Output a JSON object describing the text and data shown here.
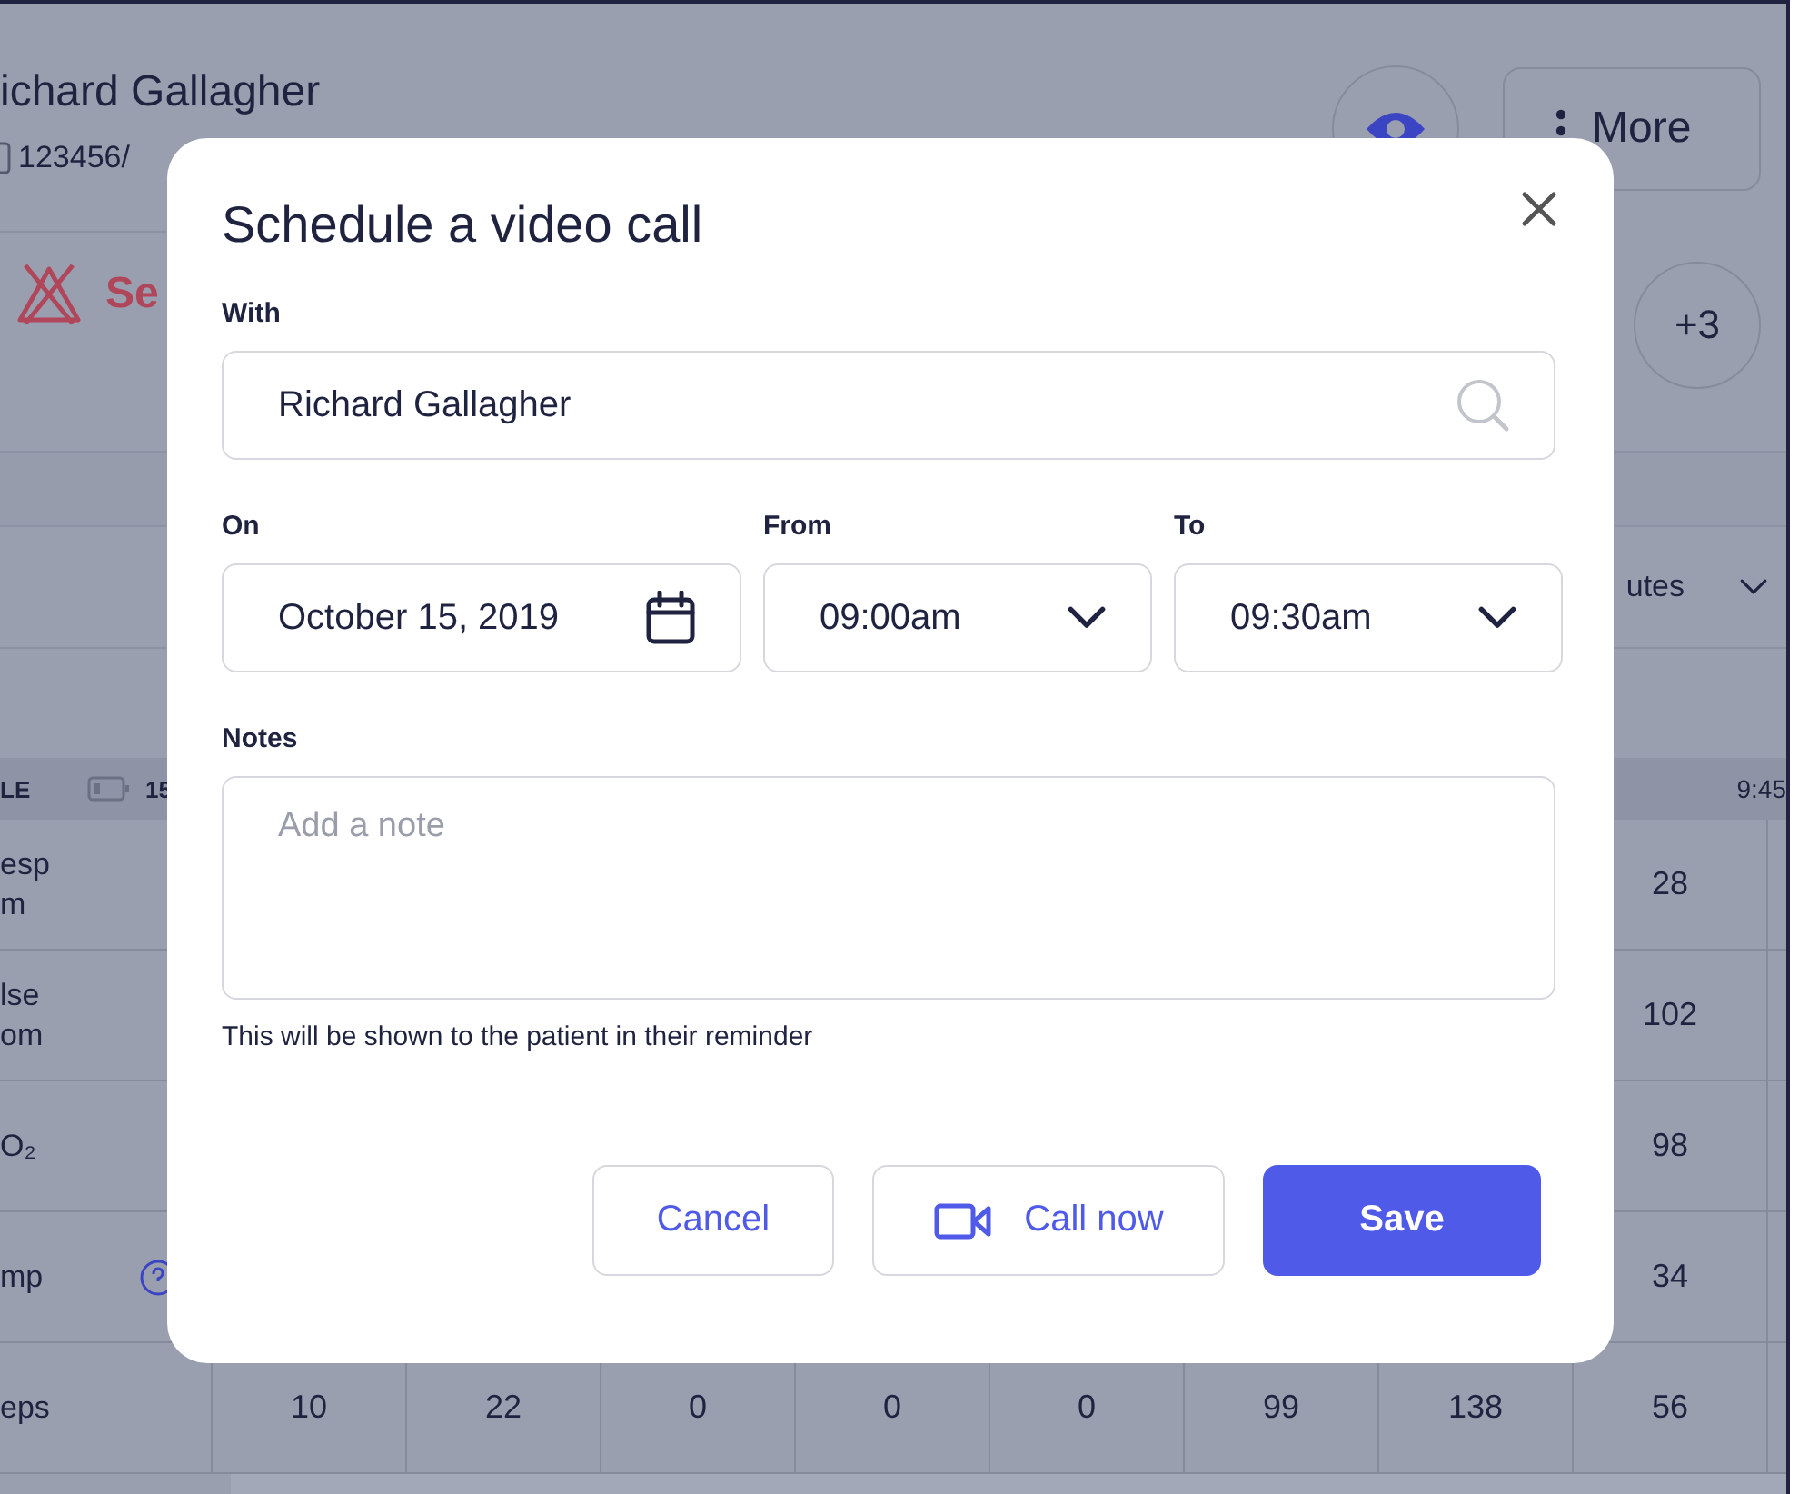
{
  "header": {
    "name": "ichard Gallagher",
    "id": "123456/",
    "alert": "Se",
    "more_button": "More",
    "extra_count": "+3"
  },
  "filter": {
    "value": "utes"
  },
  "table": {
    "header_label": "LE",
    "battery_reading": "15",
    "time": "9:45",
    "rows": [
      {
        "label": [
          "esp",
          "m"
        ],
        "help": false,
        "cells": [
          null,
          null,
          null,
          null,
          null,
          null,
          null,
          "28"
        ]
      },
      {
        "label": [
          "lse",
          "om"
        ],
        "help": false,
        "cells": [
          null,
          null,
          null,
          null,
          null,
          null,
          null,
          "102"
        ]
      },
      {
        "label": [
          "O₂"
        ],
        "help": false,
        "cells": [
          null,
          null,
          null,
          null,
          null,
          null,
          null,
          "98"
        ]
      },
      {
        "label": [
          "mp"
        ],
        "help": true,
        "cells": [
          null,
          null,
          null,
          null,
          null,
          null,
          null,
          "34"
        ]
      },
      {
        "label": [
          "eps"
        ],
        "help": false,
        "cells": [
          "10",
          "22",
          "0",
          "0",
          "0",
          "99",
          "138",
          "56"
        ]
      }
    ]
  },
  "dialog": {
    "title": "Schedule a video call",
    "with": {
      "label": "With",
      "value": "Richard Gallagher"
    },
    "on": {
      "label": "On",
      "value": "October 15, 2019"
    },
    "from": {
      "label": "From",
      "value": "09:00am"
    },
    "to": {
      "label": "To",
      "value": "09:30am"
    },
    "notes": {
      "label": "Notes",
      "placeholder": "Add a note",
      "hint": "This will be shown to the patient in their reminder"
    },
    "buttons": [
      {
        "label": "Cancel",
        "kind": "secondary"
      },
      {
        "label": "Call now",
        "kind": "video"
      },
      {
        "label": "Save",
        "kind": "primary"
      }
    ]
  }
}
